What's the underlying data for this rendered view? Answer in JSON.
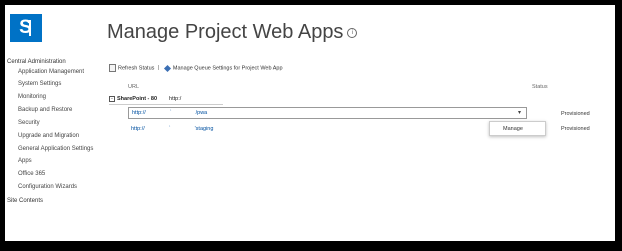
{
  "page": {
    "title": "Manage Project Web Apps",
    "info_icon_glyph": "i"
  },
  "logo": {
    "glyph": "S",
    "color": "#0072c6"
  },
  "nav": {
    "header": "Central Administration",
    "items": [
      "Application Management",
      "System Settings",
      "Monitoring",
      "Backup and Restore",
      "Security",
      "Upgrade and Migration",
      "General Application Settings",
      "Apps",
      "Office 365",
      "Configuration Wizards"
    ],
    "footer": "Site Contents"
  },
  "toolbar": {
    "refresh_label": "Refresh Status",
    "separator": "|",
    "manage_queue_label": "Manage Queue Settings for Project Web App"
  },
  "table": {
    "columns": {
      "url": "URL",
      "status": "Status"
    },
    "group": {
      "toggle": "−",
      "name": "SharePoint - 80",
      "value": "http:/"
    },
    "rows": [
      {
        "url_prefix": "http://",
        "url_mid": "`",
        "url_suffix": "/pwa",
        "status": "Provisioned",
        "dropdown": "▾"
      },
      {
        "url_prefix": "http://",
        "url_mid": "`",
        "url_suffix": "'staging",
        "status": "Provisioned"
      }
    ]
  },
  "context_menu": {
    "items": [
      "Manage"
    ]
  }
}
